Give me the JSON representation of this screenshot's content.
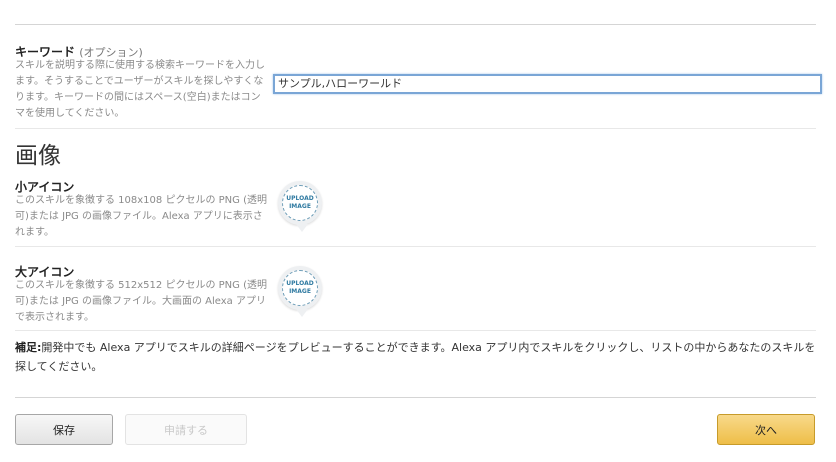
{
  "keyword": {
    "label": "キーワード",
    "optional": "(オプション)",
    "description": "スキルを説明する際に使用する検索キーワードを入力します。そうすることでユーザーがスキルを探しやすくなります。キーワードの間にはスペース(空白)またはコンマを使用してください。",
    "value": "サンプル,ハローワールド"
  },
  "images": {
    "section_title": "画像",
    "small_icon": {
      "label": "小アイコン",
      "description": "このスキルを象徴する 108x108 ピクセルの PNG (透明可)または JPG の画像ファイル。Alexa アプリに表示されます。",
      "upload_text": "UPLOAD IMAGE"
    },
    "large_icon": {
      "label": "大アイコン",
      "description": "このスキルを象徴する 512x512 ピクセルの PNG (透明可)または JPG の画像ファイル。大画面の Alexa アプリで表示されます。",
      "upload_text": "UPLOAD IMAGE"
    }
  },
  "note": {
    "prefix": "補足:",
    "text": "開発中でも Alexa アプリでスキルの詳細ページをプレビューすることができます。Alexa アプリ内でスキルをクリックし、リストの中からあなたのスキルを探してください。"
  },
  "buttons": {
    "save": "保存",
    "submit": "申請する",
    "next": "次へ"
  }
}
